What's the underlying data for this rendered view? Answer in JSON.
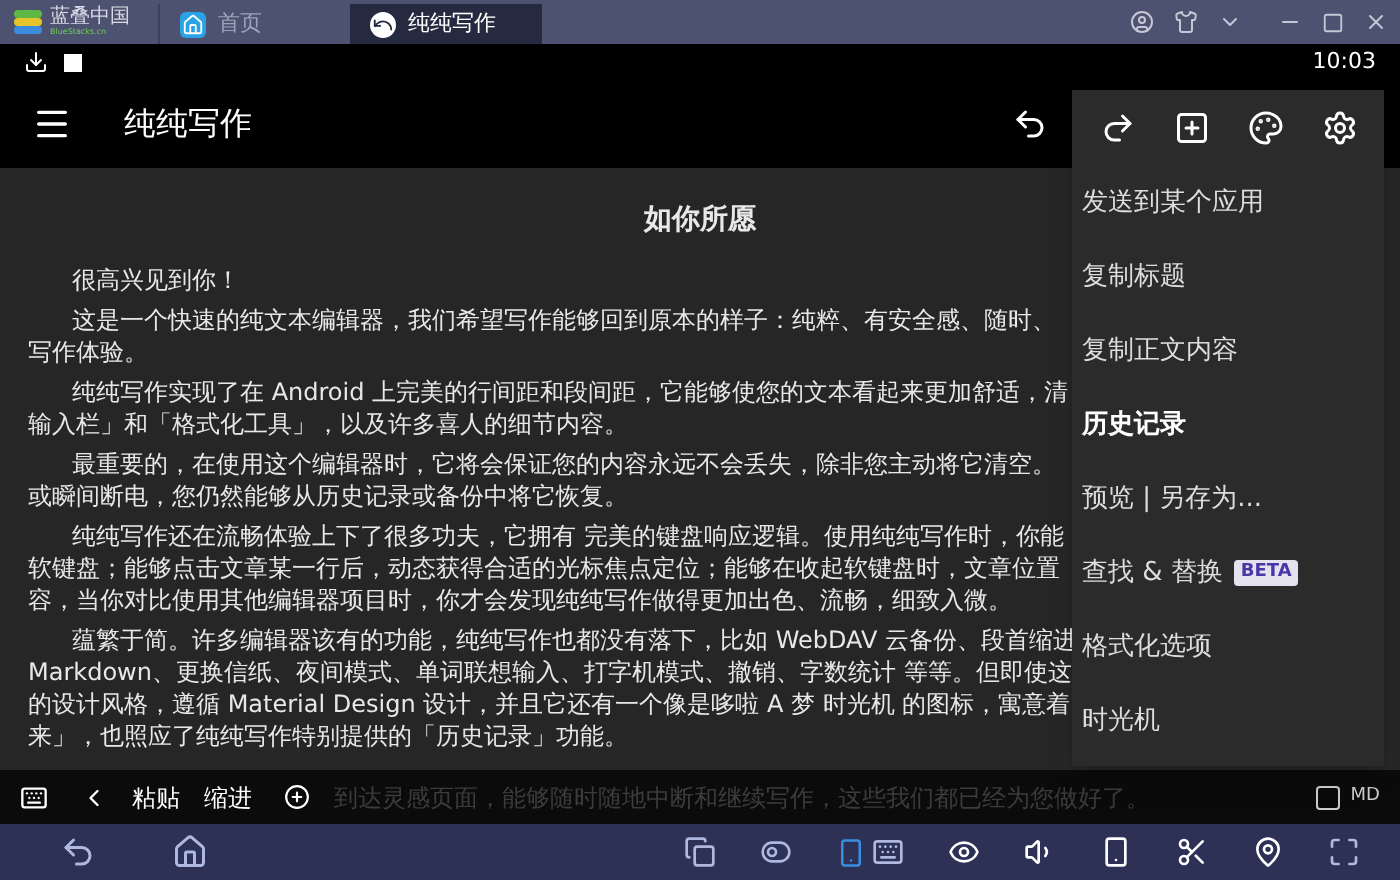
{
  "window": {
    "logo_text": "蓝叠中国",
    "logo_subtext": "BlueStacks.cn",
    "tabs": [
      {
        "label": "首页",
        "selected": false
      },
      {
        "label": "纯纯写作",
        "selected": true
      }
    ]
  },
  "status_bar": {
    "time": "10:03"
  },
  "app_bar": {
    "title": "纯纯写作"
  },
  "document": {
    "title": "如你所愿",
    "paragraphs": [
      [
        "很高兴见到你！"
      ],
      [
        "这是一个快速的纯文本编辑器，我们希望写作能够回到原本的样子：纯粹、有安全感、随时、",
        "写作体验。"
      ],
      [
        "纯纯写作实现了在 Android 上完美的行间距和段间距，它能够使您的文本看起来更加舒适，清",
        "输入栏」和「格式化工具」，以及许多喜人的细节内容。"
      ],
      [
        "最重要的，在使用这个编辑器时，它将会保证您的内容永远不会丢失，除非您主动将它清空。",
        "或瞬间断电，您仍然能够从历史记录或备份中将它恢复。"
      ],
      [
        "纯纯写作还在流畅体验上下了很多功夫，它拥有 完美的键盘响应逻辑。使用纯纯写作时，你能",
        "软键盘；能够点击文章某一行后，动态获得合适的光标焦点定位；能够在收起软键盘时，文章位置",
        "容，当你对比使用其他编辑器项目时，你才会发现纯纯写作做得更加出色、流畅，细致入微。"
      ],
      [
        "蕴繁于简。许多编辑器该有的功能，纯纯写作也都没有落下，比如 WebDAV 云备份、段首缩进",
        "Markdown、更换信纸、夜间模式、单词联想输入、打字机模式、撤销、字数统计 等等。但即使这",
        "的设计风格，遵循 Material Design 设计，并且它还有一个像是哆啦 A 梦 时光机 的图标，寓意着",
        "来」，也照应了纯纯写作特别提供的「历史记录」功能。"
      ]
    ]
  },
  "menu": {
    "items": [
      {
        "label": "发送到某个应用",
        "emphasized": false
      },
      {
        "label": "复制标题",
        "emphasized": false
      },
      {
        "label": "复制正文内容",
        "emphasized": false
      },
      {
        "label": "历史记录",
        "emphasized": true
      },
      {
        "label": "预览 | 另存为...",
        "emphasized": false
      },
      {
        "label": "查找 & 替换",
        "emphasized": false,
        "badge": "BETA"
      },
      {
        "label": "格式化选项",
        "emphasized": false
      },
      {
        "label": "时光机",
        "emphasized": false
      }
    ]
  },
  "edit_toolbar": {
    "buttons": [
      "粘贴",
      "缩进"
    ],
    "faded_text": "到达灵感页面，能够随时随地中断和继续写作，这些我们都已经为您做好了。",
    "md_toggle": {
      "label": "MD",
      "checked": false
    }
  }
}
